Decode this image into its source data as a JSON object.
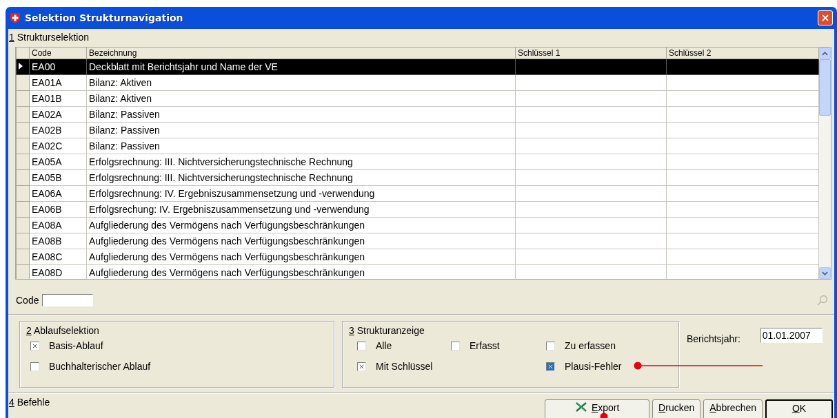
{
  "window": {
    "title": "Selektion Strukturnavigation"
  },
  "structure_section": {
    "title": "1 Strukturselektion"
  },
  "table": {
    "columns": [
      "Code",
      "Bezeichnung",
      "Schlüssel 1",
      "Schlüssel 2"
    ],
    "rows": [
      {
        "code": "EA00",
        "name": "Deckblatt mit Berichtsjahr  und Name der VE",
        "selected": true
      },
      {
        "code": "EA01A",
        "name": "Bilanz: Aktiven",
        "selected": false
      },
      {
        "code": "EA01B",
        "name": "Bilanz: Aktiven",
        "selected": false
      },
      {
        "code": "EA02A",
        "name": "Bilanz: Passiven",
        "selected": false
      },
      {
        "code": "EA02B",
        "name": "Bilanz: Passiven",
        "selected": false
      },
      {
        "code": "EA02C",
        "name": "Bilanz: Passiven",
        "selected": false
      },
      {
        "code": "EA05A",
        "name": "Erfolgsrechnung: III. Nichtversicherungstechnische Rechnung",
        "selected": false
      },
      {
        "code": "EA05B",
        "name": "Erfolgsrechnung: III. Nichtversicherungstechnische Rechnung",
        "selected": false
      },
      {
        "code": "EA06A",
        "name": "Erfolgsrechnung: IV. Ergebniszusammensetzung und -verwendung",
        "selected": false
      },
      {
        "code": "EA06B",
        "name": "Erfolgsrechung: IV. Ergebniszusammensetzung und -verwendung",
        "selected": false
      },
      {
        "code": "EA08A",
        "name": "Aufgliederung des Vermögens nach Verfügungsbeschränkungen",
        "selected": false
      },
      {
        "code": "EA08B",
        "name": "Aufgliederung des Vermögens nach Verfügungsbeschränkungen",
        "selected": false
      },
      {
        "code": "EA08C",
        "name": "Aufgliederung des Vermögens nach Verfügungsbeschränkungen",
        "selected": false
      },
      {
        "code": "EA08D",
        "name": "Aufgliederung des Vermögens nach Verfügungsbeschränkungen",
        "selected": false
      }
    ]
  },
  "code_filter": {
    "label": "Code"
  },
  "process_group": {
    "title": "2 Ablaufselektion",
    "options": [
      {
        "label": "Basis-Ablauf",
        "checked": true
      },
      {
        "label": "Buchhalterischer Ablauf",
        "checked": false
      }
    ]
  },
  "display_group": {
    "title": "3 Strukturanzeige",
    "options": [
      {
        "label": "Alle",
        "checked": false
      },
      {
        "label": "Erfasst",
        "checked": false
      },
      {
        "label": "Zu erfassen",
        "checked": false
      },
      {
        "label": "Mit Schlüssel",
        "checked": true
      },
      {
        "label": "Plausi-Fehler",
        "checked": true,
        "focused": true
      }
    ]
  },
  "report_year": {
    "label": "Berichtsjahr:",
    "value": "01.01.2007"
  },
  "commands": {
    "title": "4 Befehle",
    "buttons": [
      {
        "label": "Export",
        "kind": "export"
      },
      {
        "label": "Drucken",
        "kind": "plain"
      },
      {
        "label": "Abbrechen",
        "kind": "plain"
      },
      {
        "label": "OK",
        "kind": "default"
      }
    ]
  }
}
